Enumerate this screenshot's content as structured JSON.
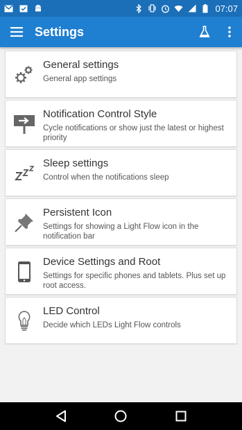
{
  "status_bar": {
    "time": "07:07",
    "left_icons": [
      "gmail-icon",
      "calendar-icon",
      "android-icon"
    ],
    "right_icons": [
      "bluetooth-icon",
      "vibrate-icon",
      "alarm-icon",
      "wifi-icon",
      "signal-icon",
      "battery-icon"
    ]
  },
  "app_bar": {
    "title": "Settings",
    "menu_icon": "hamburger-menu-icon",
    "actions": [
      "flask-icon",
      "overflow-menu-icon"
    ],
    "color": "#1f7fd1"
  },
  "settings": [
    {
      "icon": "gears-icon",
      "title": "General settings",
      "subtitle": "General app settings"
    },
    {
      "icon": "sign-arrow-icon",
      "title": "Notification Control Style",
      "subtitle": "Cycle notifications or show just the latest or highest priority"
    },
    {
      "icon": "zzz-icon",
      "title": "Sleep settings",
      "subtitle": "Control when the notifications sleep"
    },
    {
      "icon": "pushpin-icon",
      "title": "Persistent Icon",
      "subtitle": "Settings for showing a Light Flow icon in the notification bar"
    },
    {
      "icon": "phone-icon",
      "title": "Device Settings and Root",
      "subtitle": "Settings for specific phones and tablets. Plus set up root access."
    },
    {
      "icon": "lightbulb-icon",
      "title": "LED Control",
      "subtitle": "Decide which LEDs Light Flow controls"
    }
  ],
  "nav_bar": {
    "buttons": [
      "back-icon",
      "home-icon",
      "recents-icon"
    ]
  }
}
